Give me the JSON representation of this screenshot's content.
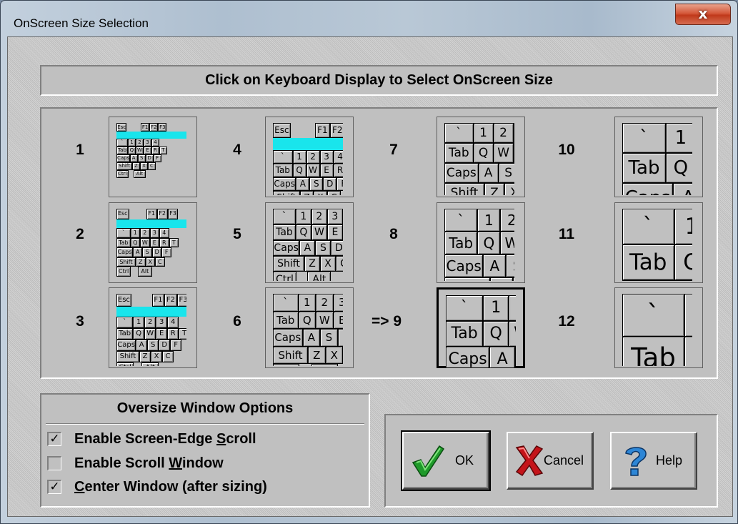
{
  "window": {
    "title": "OnScreen Size Selection",
    "close_glyph": "x"
  },
  "header": {
    "text": "Click on Keyboard Display to Select OnScreen Size"
  },
  "sizes": [
    {
      "label": "1"
    },
    {
      "label": "2"
    },
    {
      "label": "3"
    },
    {
      "label": "4"
    },
    {
      "label": "5"
    },
    {
      "label": "6"
    },
    {
      "label": "7"
    },
    {
      "label": "8"
    },
    {
      "label": "=> 9",
      "selected": true
    },
    {
      "label": "10"
    },
    {
      "label": "11"
    },
    {
      "label": "12"
    }
  ],
  "thumb_keys": {
    "esc": "Esc",
    "f1": "F1",
    "f2": "F2",
    "f3": "F3",
    "tick": "`",
    "n1": "1",
    "n2": "2",
    "n3": "3",
    "n4": "4",
    "tab": "Tab",
    "q": "Q",
    "w": "W",
    "e": "E",
    "r": "R",
    "t": "T",
    "caps": "Caps",
    "a": "A",
    "s": "S",
    "d": "D",
    "f": "F",
    "shift": "Shift",
    "z": "Z",
    "x": "X",
    "c": "C",
    "ctrl": "Ctrl",
    "alt": "Alt"
  },
  "options": {
    "title": "Oversize Window Options",
    "items": [
      {
        "label_pre": "Enable Screen-Edge ",
        "label_u": "S",
        "label_post": "croll",
        "checked": true
      },
      {
        "label_pre": "Enable Scroll ",
        "label_u": "W",
        "label_post": "indow",
        "checked": false
      },
      {
        "label_pre": "",
        "label_u": "C",
        "label_post": "enter Window (after sizing)",
        "checked": true
      }
    ],
    "check_glyph": "✓"
  },
  "buttons": {
    "ok": "OK",
    "cancel": "Cancel",
    "help": "Help"
  },
  "colors": {
    "highlight": "#19e5ec",
    "face": "#c0c0c0"
  }
}
